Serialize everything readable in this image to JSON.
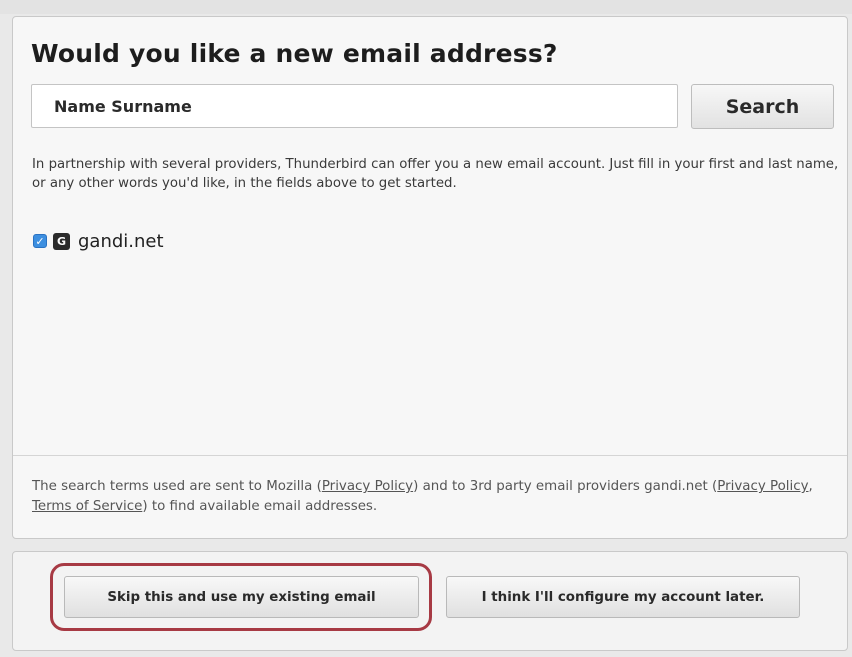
{
  "dialog": {
    "heading": "Would you like a new email address?",
    "search": {
      "value": "Name Surname",
      "button_label": "Search"
    },
    "description": "In partnership with several providers, Thunderbird can offer you a new email account. Just fill in your first and last name, or any other words you'd like, in the fields above to get started.",
    "providers": [
      {
        "name": "gandi.net",
        "checked": true,
        "logo_letter": "G",
        "logo_icon": "gandi-logo-icon",
        "check_icon": "checkmark-icon"
      }
    ],
    "privacy": {
      "text_1": "The search terms used are sent to Mozilla (",
      "link_mozilla_privacy": "Privacy Policy",
      "text_2": ") and to 3rd party email providers gandi.net (",
      "link_gandi_privacy": "Privacy Policy",
      "text_3": ", ",
      "link_gandi_terms": "Terms of Service",
      "text_4": ") to find available email addresses."
    }
  },
  "footer": {
    "skip_label": "Skip this and use my existing email",
    "later_label": "I think I'll configure my account later."
  },
  "colors": {
    "highlight_ring": "#a73a44",
    "checkbox": "#3d8fe0",
    "panel_background": "#f7f7f7"
  }
}
